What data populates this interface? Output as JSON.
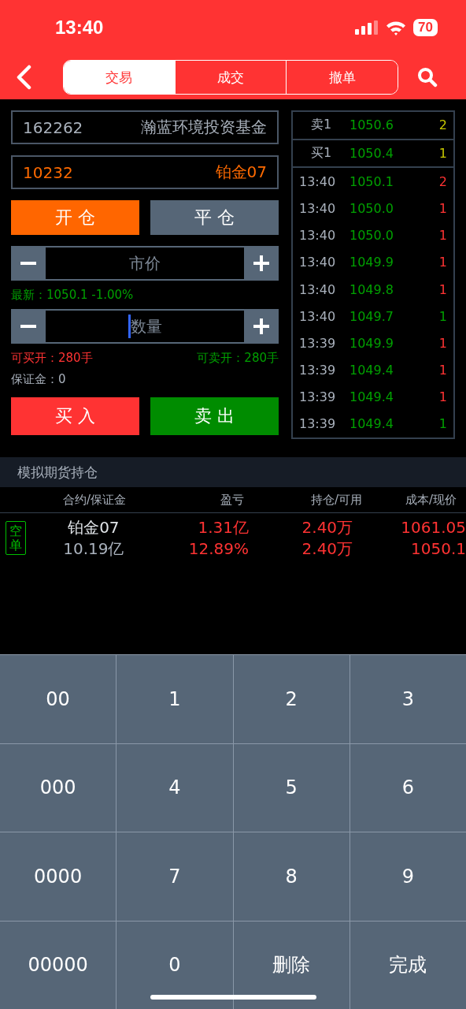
{
  "status_bar": {
    "time": "13:40",
    "battery": "70"
  },
  "tabs": [
    {
      "label": "交易",
      "selected": true
    },
    {
      "label": "成交",
      "selected": false
    },
    {
      "label": "撤单",
      "selected": false
    }
  ],
  "fund": {
    "code": "162262",
    "name": "瀚蓝环境投资基金"
  },
  "contract": {
    "code": "10232",
    "name": "铂金07"
  },
  "mode_buttons": [
    {
      "label": "开 仓",
      "selected": true
    },
    {
      "label": "平 仓",
      "selected": false
    }
  ],
  "price_field": {
    "placeholder": "市价",
    "focused": false
  },
  "latest": "最新：1050.1  -1.00%",
  "quantity_field": {
    "placeholder": "数量",
    "focused": true
  },
  "can_buy": "可买开：280手",
  "can_sell": "可卖开：280手",
  "margin": "保证金：0",
  "buy_button": "买 入",
  "sell_button": "卖 出",
  "quotes": [
    {
      "label": "卖1",
      "price": "1050.6",
      "volume": "2"
    },
    {
      "label": "买1",
      "price": "1050.4",
      "volume": "1"
    }
  ],
  "trades": [
    {
      "time": "13:40",
      "price": "1050.1",
      "volume": "2",
      "color": "#ff3333"
    },
    {
      "time": "13:40",
      "price": "1050.0",
      "volume": "1",
      "color": "#ff3333"
    },
    {
      "time": "13:40",
      "price": "1050.0",
      "volume": "1",
      "color": "#ff3333"
    },
    {
      "time": "13:40",
      "price": "1049.9",
      "volume": "1",
      "color": "#ff3333"
    },
    {
      "time": "13:40",
      "price": "1049.8",
      "volume": "1",
      "color": "#ff3333"
    },
    {
      "time": "13:40",
      "price": "1049.7",
      "volume": "1",
      "color": "#00a000"
    },
    {
      "time": "13:39",
      "price": "1049.9",
      "volume": "1",
      "color": "#ff3333"
    },
    {
      "time": "13:39",
      "price": "1049.4",
      "volume": "1",
      "color": "#ff3333"
    },
    {
      "time": "13:39",
      "price": "1049.4",
      "volume": "1",
      "color": "#ff3333"
    },
    {
      "time": "13:39",
      "price": "1049.4",
      "volume": "1",
      "color": "#00a000"
    }
  ],
  "positions": {
    "title": "模拟期货持仓",
    "columns": [
      "合约/保证金",
      "盈亏",
      "持仓/可用",
      "成本/现价"
    ],
    "rows": [
      {
        "tag": "空单",
        "contract": "铂金07",
        "margin": "10.19亿",
        "pnl": "1.31亿",
        "pnl_pct": "12.89%",
        "holding": "2.40万",
        "available": "2.40万",
        "cost": "1061.05",
        "current": "1050.1"
      }
    ]
  },
  "keypad": [
    "00",
    "1",
    "2",
    "3",
    "000",
    "4",
    "5",
    "6",
    "0000",
    "7",
    "8",
    "9",
    "00000",
    "0",
    "删除",
    "完成"
  ]
}
